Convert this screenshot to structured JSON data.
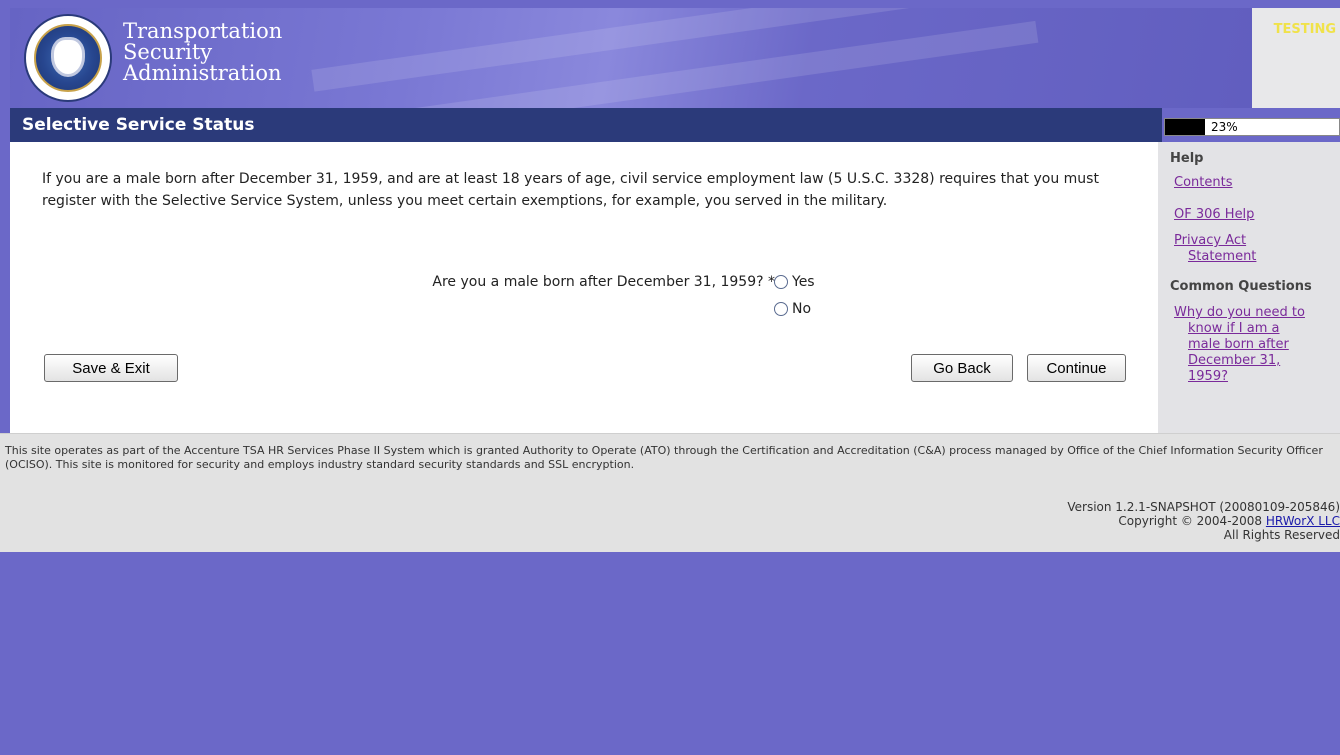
{
  "header": {
    "agency_lines": [
      "Transportation",
      "Security",
      "Administration"
    ],
    "testing_label": "TESTING"
  },
  "page": {
    "title": "Selective Service Status",
    "progress_percent": 23,
    "progress_label": "23%"
  },
  "main": {
    "intro": "If you are a male born after December 31, 1959, and are at least 18 years of age, civil service employment law (5 U.S.C. 3328) requires that you must register with the Selective Service System, unless you meet certain exemptions, for example, you served in the military.",
    "question": "Are you a male born after December 31, 1959? *",
    "options": [
      "Yes",
      "No"
    ],
    "selected": null,
    "buttons": {
      "save_exit": "Save & Exit",
      "go_back": "Go Back",
      "continue": "Continue"
    }
  },
  "help": {
    "heading": "Help",
    "links": {
      "contents": "Contents",
      "of306": "OF 306 Help",
      "privacy_line1": "Privacy Act",
      "privacy_line2": "Statement"
    },
    "common_heading": "Common Questions",
    "question_lines": [
      "Why do you need to",
      "know if I am a",
      "male born after",
      "December 31,",
      "1959?"
    ]
  },
  "footer": {
    "note": "This site operates as part of the Accenture TSA HR Services Phase II System which is granted Authority to Operate (ATO) through the Certification and Accreditation (C&A) process managed by Office of the Chief Information Security Officer (OCISO). This site is monitored for security and employs industry standard security standards and SSL encryption.",
    "version": "Version 1.2.1-SNAPSHOT (20080109-205846)",
    "copyright_prefix": "Copyright © 2004-2008 ",
    "copyright_link": "HRWorX LLC",
    "rights": "All Rights Reserved"
  },
  "colors": {
    "page_bg": "#6b68c8",
    "title_bar": "#2b3a7a",
    "help_link": "#7a2a9a",
    "testing": "#f0e24a"
  }
}
